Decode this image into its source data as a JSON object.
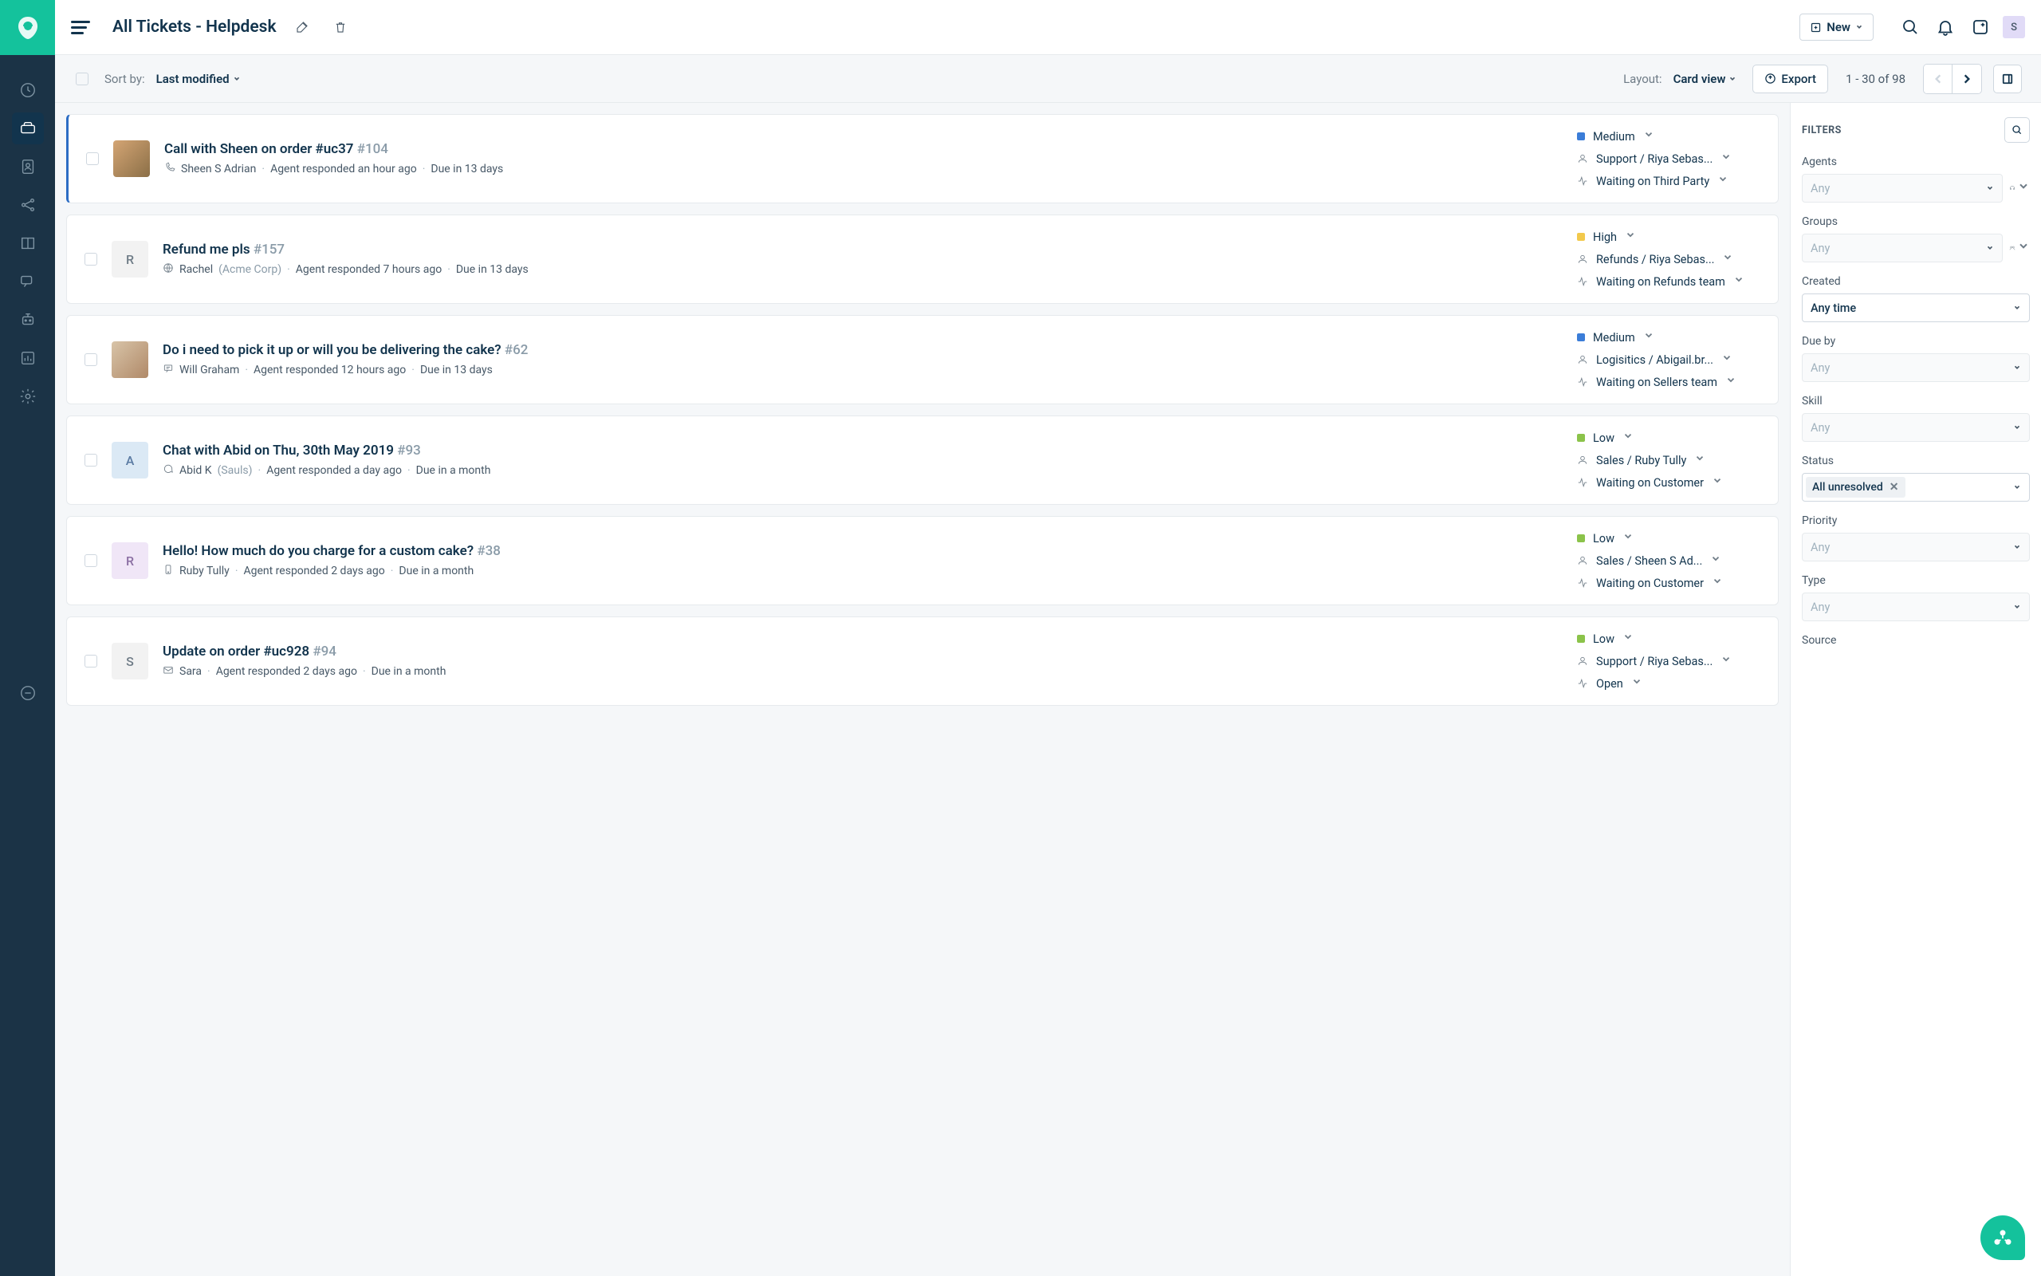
{
  "header": {
    "title": "All Tickets - Helpdesk",
    "new_label": "New",
    "avatar_letter": "S"
  },
  "toolbar": {
    "sort_label": "Sort by:",
    "sort_value": "Last modified",
    "layout_label": "Layout:",
    "layout_value": "Card view",
    "export_label": "Export",
    "page_info": "1 - 30 of 98"
  },
  "tickets": [
    {
      "title": "Call with Sheen on order #uc37",
      "id": "#104",
      "source": "call",
      "contact": "Sheen S Adrian",
      "company": "",
      "agent_resp": "Agent responded an hour ago",
      "due": "Due in 13 days",
      "priority": "Medium",
      "pri_class": "pri-medium",
      "assignee": "Support / Riya Sebas...",
      "status": "Waiting on Third Party",
      "avatar_class": "img-ph",
      "avatar_letter": "",
      "selected": true
    },
    {
      "title": "Refund me pls",
      "id": "#157",
      "source": "portal",
      "contact": "Rachel",
      "company": "(Acme Corp)",
      "agent_resp": "Agent responded 7 hours ago",
      "due": "Due in 13 days",
      "priority": "High",
      "pri_class": "pri-high",
      "assignee": "Refunds / Riya Sebas...",
      "status": "Waiting on Refunds team",
      "avatar_class": "letter-r",
      "avatar_letter": "R",
      "selected": false
    },
    {
      "title": "Do i need to pick it up or will you be delivering the cake?",
      "id": "#62",
      "source": "feedback",
      "contact": "Will Graham",
      "company": "",
      "agent_resp": "Agent responded 12 hours ago",
      "due": "Due in 13 days",
      "priority": "Medium",
      "pri_class": "pri-medium",
      "assignee": "Logisitics / Abigail.br...",
      "status": "Waiting on Sellers team",
      "avatar_class": "img-ph2",
      "avatar_letter": "",
      "selected": false
    },
    {
      "title": "Chat with Abid on Thu, 30th May 2019",
      "id": "#93",
      "source": "chat",
      "contact": "Abid K",
      "company": "(Sauls)",
      "agent_resp": "Agent responded a day ago",
      "due": "Due in a month",
      "priority": "Low",
      "pri_class": "pri-low",
      "assignee": "Sales / Ruby Tully",
      "status": "Waiting on Customer",
      "avatar_class": "letter-a",
      "avatar_letter": "A",
      "selected": false
    },
    {
      "title": "Hello! How much do you charge for a custom cake?",
      "id": "#38",
      "source": "mobile",
      "contact": "Ruby Tully",
      "company": "",
      "agent_resp": "Agent responded 2 days ago",
      "due": "Due in a month",
      "priority": "Low",
      "pri_class": "pri-low",
      "assignee": "Sales / Sheen S Ad...",
      "status": "Waiting on Customer",
      "avatar_class": "letter-rp",
      "avatar_letter": "R",
      "selected": false
    },
    {
      "title": "Update on order #uc928",
      "id": "#94",
      "source": "email",
      "contact": "Sara",
      "company": "",
      "agent_resp": "Agent responded 2 days ago",
      "due": "Due in a month",
      "priority": "Low",
      "pri_class": "pri-low",
      "assignee": "Support / Riya Sebas...",
      "status": "Open",
      "avatar_class": "letter-s",
      "avatar_letter": "S",
      "selected": false
    }
  ],
  "filters": {
    "title": "FILTERS",
    "groups": {
      "agents": {
        "label": "Agents",
        "value": "Any"
      },
      "groups": {
        "label": "Groups",
        "value": "Any"
      },
      "created": {
        "label": "Created",
        "value": "Any time"
      },
      "dueby": {
        "label": "Due by",
        "value": "Any"
      },
      "skill": {
        "label": "Skill",
        "value": "Any"
      },
      "status": {
        "label": "Status",
        "tag": "All unresolved"
      },
      "priority": {
        "label": "Priority",
        "value": "Any"
      },
      "type": {
        "label": "Type",
        "value": "Any"
      },
      "source": {
        "label": "Source"
      }
    }
  }
}
